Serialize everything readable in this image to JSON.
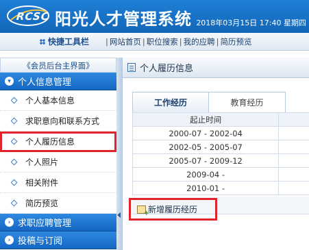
{
  "header": {
    "logo_text": "RCSC",
    "system_title": "阳光人才管理系统",
    "datetime": "2018年03月15日 17:40 星期四"
  },
  "toolbar": {
    "quick_label": "快捷工具栏",
    "links": [
      "网站首页",
      "职位搜索",
      "我的应聘",
      "简历预览"
    ],
    "separator": "|"
  },
  "sidebar": {
    "back_link": "《会员后台主界面》",
    "sections": [
      {
        "title": "个人信息管理",
        "items": [
          {
            "label": "个人基本信息",
            "active": false
          },
          {
            "label": "求职意向和联系方式",
            "active": false
          },
          {
            "label": "个人履历信息",
            "active": true
          },
          {
            "label": "个人照片",
            "active": false
          },
          {
            "label": "相关附件",
            "active": false
          },
          {
            "label": "简历预览",
            "active": false
          }
        ]
      },
      {
        "title": "求职应聘管理",
        "items": []
      },
      {
        "title": "投稿与订阅",
        "items": []
      }
    ]
  },
  "main": {
    "title": "个人履历信息",
    "tabs": [
      {
        "label": "工作经历",
        "selected": true
      },
      {
        "label": "教育经历",
        "selected": false
      }
    ],
    "table": {
      "header": "起止时间",
      "rows": [
        "2000-07 - 2002-04",
        "2002-05 - 2005-07",
        "2005-07 - 2009-12",
        "2009-04 -",
        "2010-01 -"
      ]
    },
    "add_button": "新增履历经历"
  },
  "colors": {
    "header_blue": "#1266b8",
    "section_blue": "#1466c2",
    "highlight_red": "#e0242a"
  }
}
